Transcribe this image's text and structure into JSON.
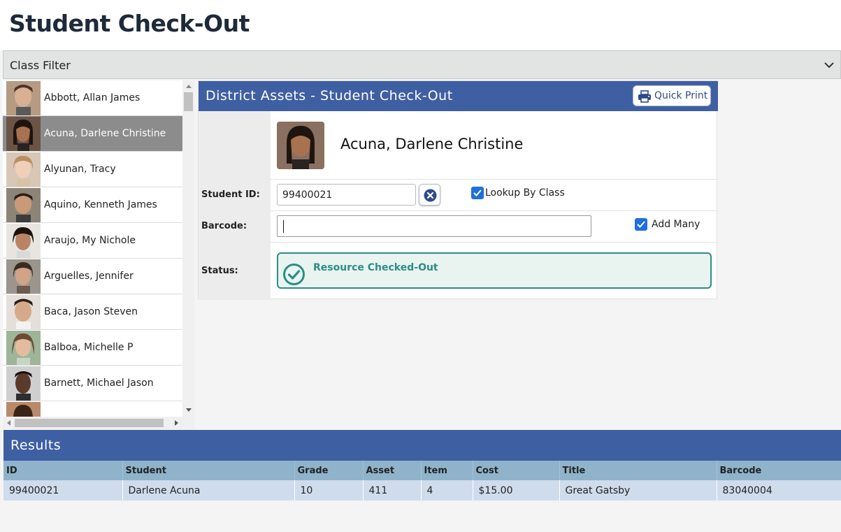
{
  "page": {
    "title": "Student Check-Out"
  },
  "class_filter": {
    "label": "Class Filter",
    "icon": "chevron-down-icon"
  },
  "students": [
    {
      "name": "Abbott, Allan James",
      "selected": false
    },
    {
      "name": "Acuna, Darlene Christine",
      "selected": true
    },
    {
      "name": "Alyunan, Tracy",
      "selected": false
    },
    {
      "name": "Aquino, Kenneth James",
      "selected": false
    },
    {
      "name": "Araujo, My Nichole",
      "selected": false
    },
    {
      "name": "Arguelles, Jennifer",
      "selected": false
    },
    {
      "name": "Baca, Jason Steven",
      "selected": false
    },
    {
      "name": "Balboa, Michelle P",
      "selected": false
    },
    {
      "name": "Barnett, Michael Jason",
      "selected": false
    }
  ],
  "checkout": {
    "title": "District Assets - Student Check-Out",
    "quick_print_label": "Quick Print",
    "student_name": "Acuna, Darlene Christine",
    "student_id_label": "Student ID:",
    "student_id_value": "99400021",
    "lookup_by_class_label": "Lookup By Class",
    "lookup_by_class_checked": true,
    "barcode_label": "Barcode:",
    "barcode_value": "",
    "add_many_label": "Add Many",
    "add_many_checked": true,
    "status_label": "Status:",
    "status_text": "Resource Checked-Out"
  },
  "results": {
    "title": "Results",
    "columns": [
      "ID",
      "Student",
      "Grade",
      "Asset",
      "Item",
      "Cost",
      "Title",
      "Barcode"
    ],
    "rows": [
      [
        "99400021",
        "Darlene Acuna",
        "10",
        "411",
        "4",
        "$15.00",
        "Great Gatsby",
        "83040004"
      ]
    ]
  },
  "colors": {
    "header_blue": "#3f5fa3",
    "status_teal": "#2b8e85",
    "table_header": "#8fb3cb",
    "table_row": "#cfdcec",
    "selected_row": "#8c8c8c"
  }
}
